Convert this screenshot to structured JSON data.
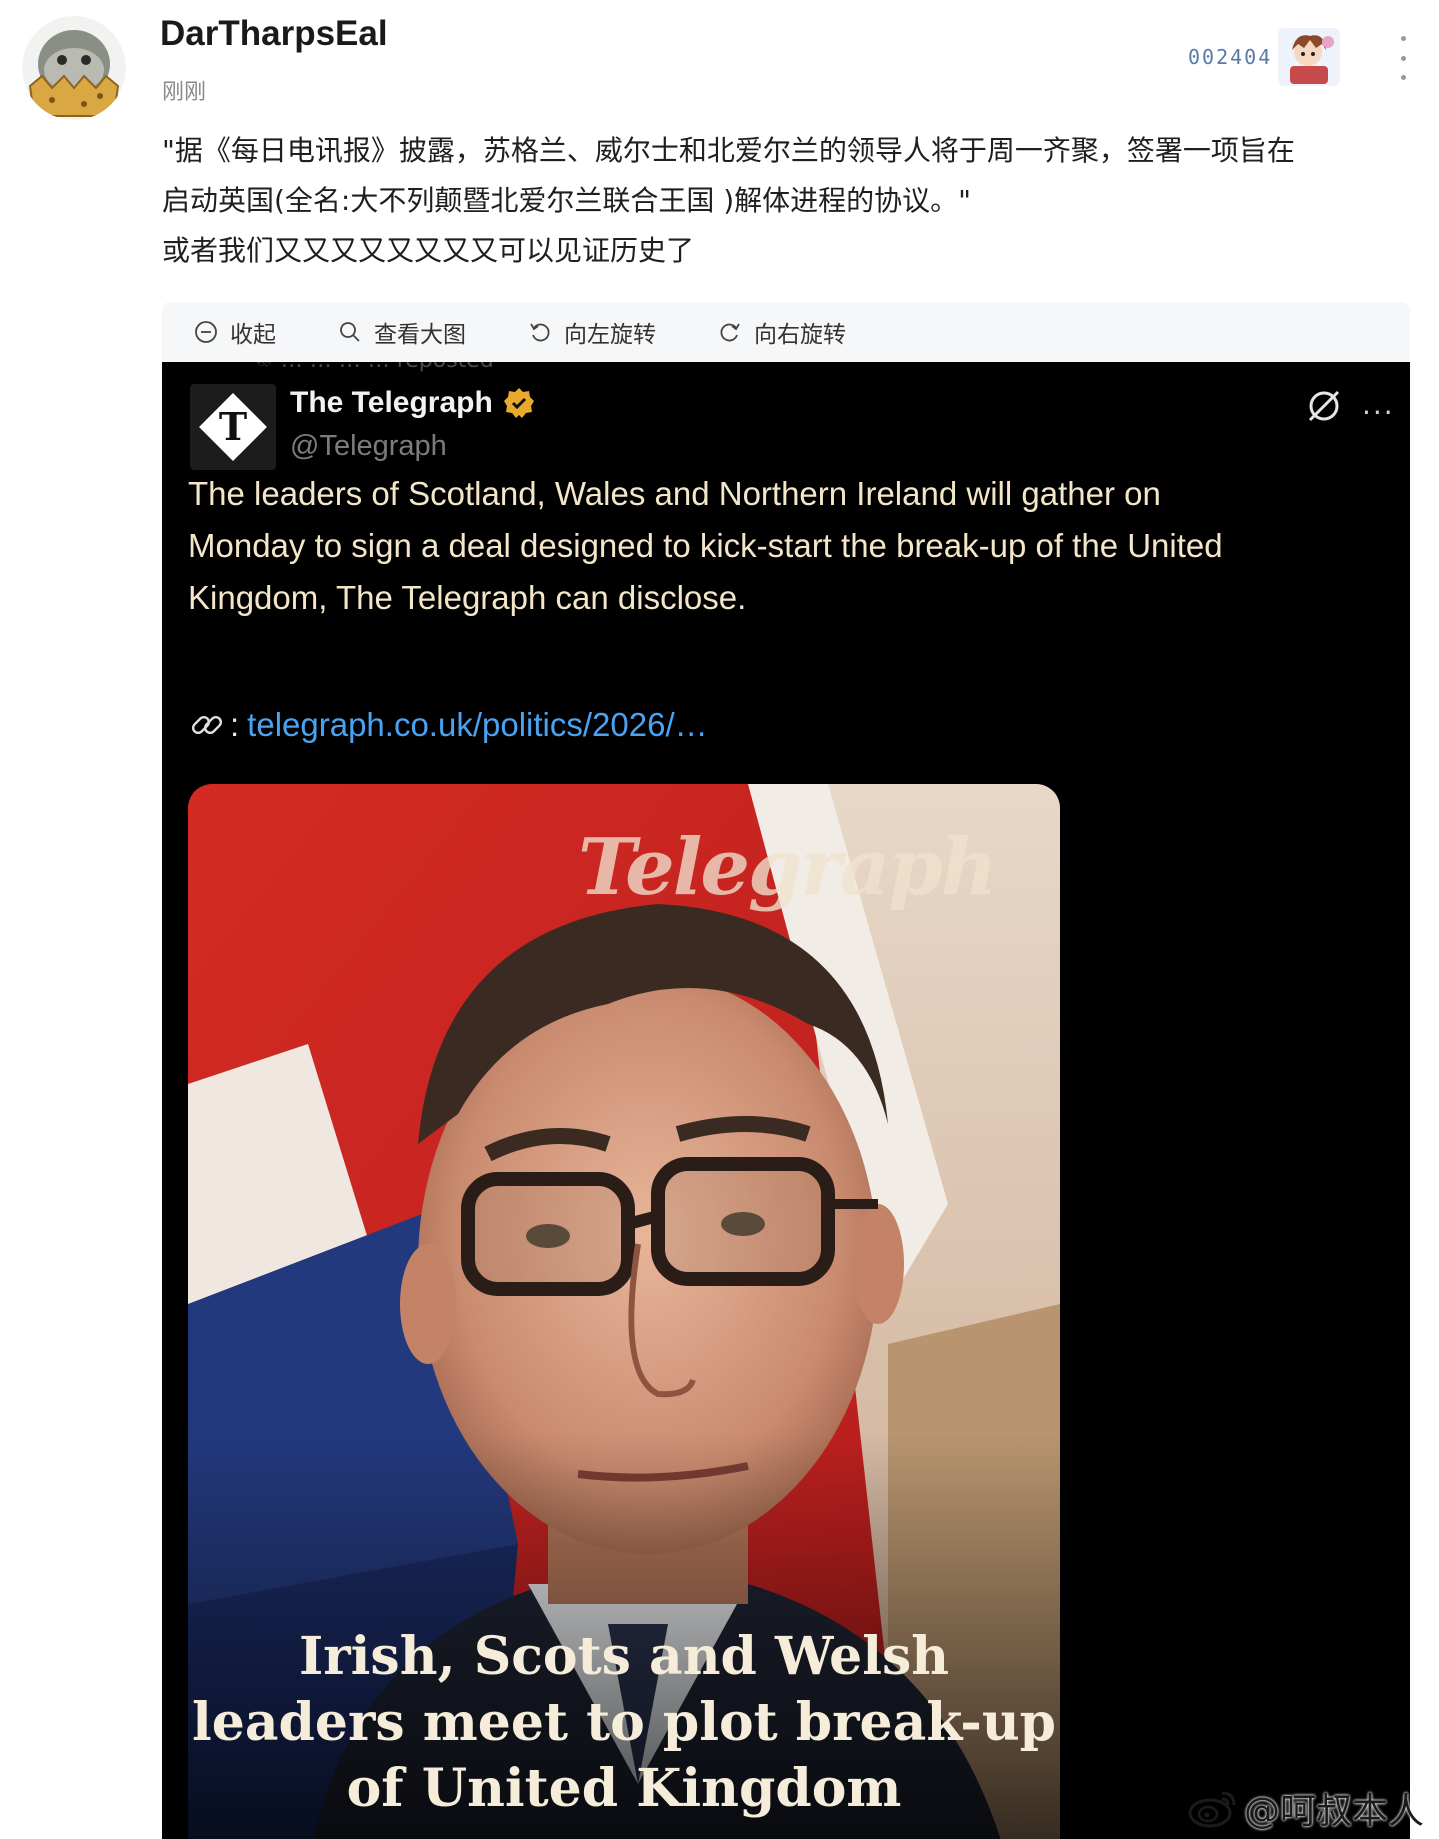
{
  "post": {
    "username": "DarTharpsEal",
    "timestamp": "刚刚",
    "badge_text": "002404",
    "text_lines": [
      "\"据《每日电讯报》披露，苏格兰、威尔士和北爱尔兰的领导人将于周一齐聚，签署一项旨在",
      "启动英国(全名:大不列颠暨北爱尔兰联合王国 )解体进程的协议。\"",
      "或者我们又又又又又又又又可以见证历史了"
    ]
  },
  "image_toolbar": {
    "collapse": "收起",
    "view_large": "查看大图",
    "rotate_left": "向左旋转",
    "rotate_right": "向右旋转"
  },
  "tweet": {
    "retweet_ghost": "♲ … … … … reposted",
    "account_name": "The Telegraph",
    "handle": "@Telegraph",
    "logo_letter": "T",
    "body_lines": [
      "The leaders of Scotland, Wales and Northern Ireland will gather on",
      "Monday to sign a deal designed to kick-start the break-up of the United",
      "Kingdom, The Telegraph can disclose."
    ],
    "link_colon": ":",
    "link_text": "telegraph.co.uk/politics/2026/…",
    "more": "···"
  },
  "news_card": {
    "brand": "Telegraph",
    "headline_lines": [
      "Irish, Scots and Welsh",
      "leaders meet to plot break-up",
      "of United Kingdom"
    ]
  },
  "watermark": {
    "text": "@呵叔本人"
  },
  "colors": {
    "tweet_bg": "#000000",
    "tweet_text": "#f4e6c8",
    "link": "#4aa3f0",
    "verified": "#e8a92e",
    "toolbar_bg": "#f6f7f9"
  }
}
